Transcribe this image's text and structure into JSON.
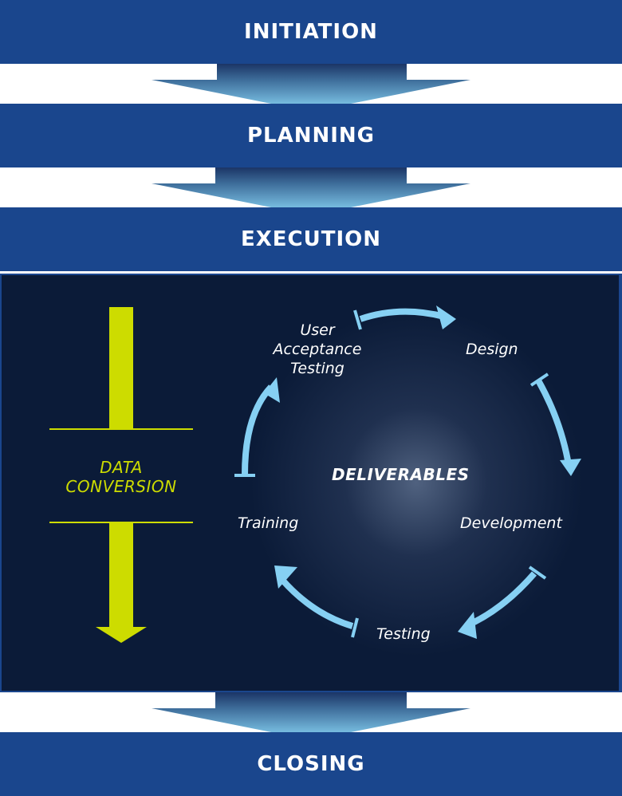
{
  "phases": {
    "initiation": "INITIATION",
    "planning": "PLANNING",
    "execution": "EXECUTION",
    "closing": "CLOSING"
  },
  "execution_panel": {
    "side_process": {
      "label_line1": "DATA",
      "label_line2": "CONVERSION"
    },
    "cycle": {
      "center_label": "DELIVERABLES",
      "stages": [
        {
          "line1": "User",
          "line2": "Acceptance",
          "line3": "Testing"
        },
        {
          "line1": "Design"
        },
        {
          "line1": "Development"
        },
        {
          "line1": "Testing"
        },
        {
          "line1": "Training"
        }
      ]
    }
  },
  "colors": {
    "phase_band": "#1a468d",
    "panel_bg": "#0b1b38",
    "data_conversion": "#cddc00",
    "cycle_arrow": "#86d0f3",
    "flow_arrow_top": "#1b3566",
    "flow_arrow_bottom": "#8ad6f6"
  }
}
